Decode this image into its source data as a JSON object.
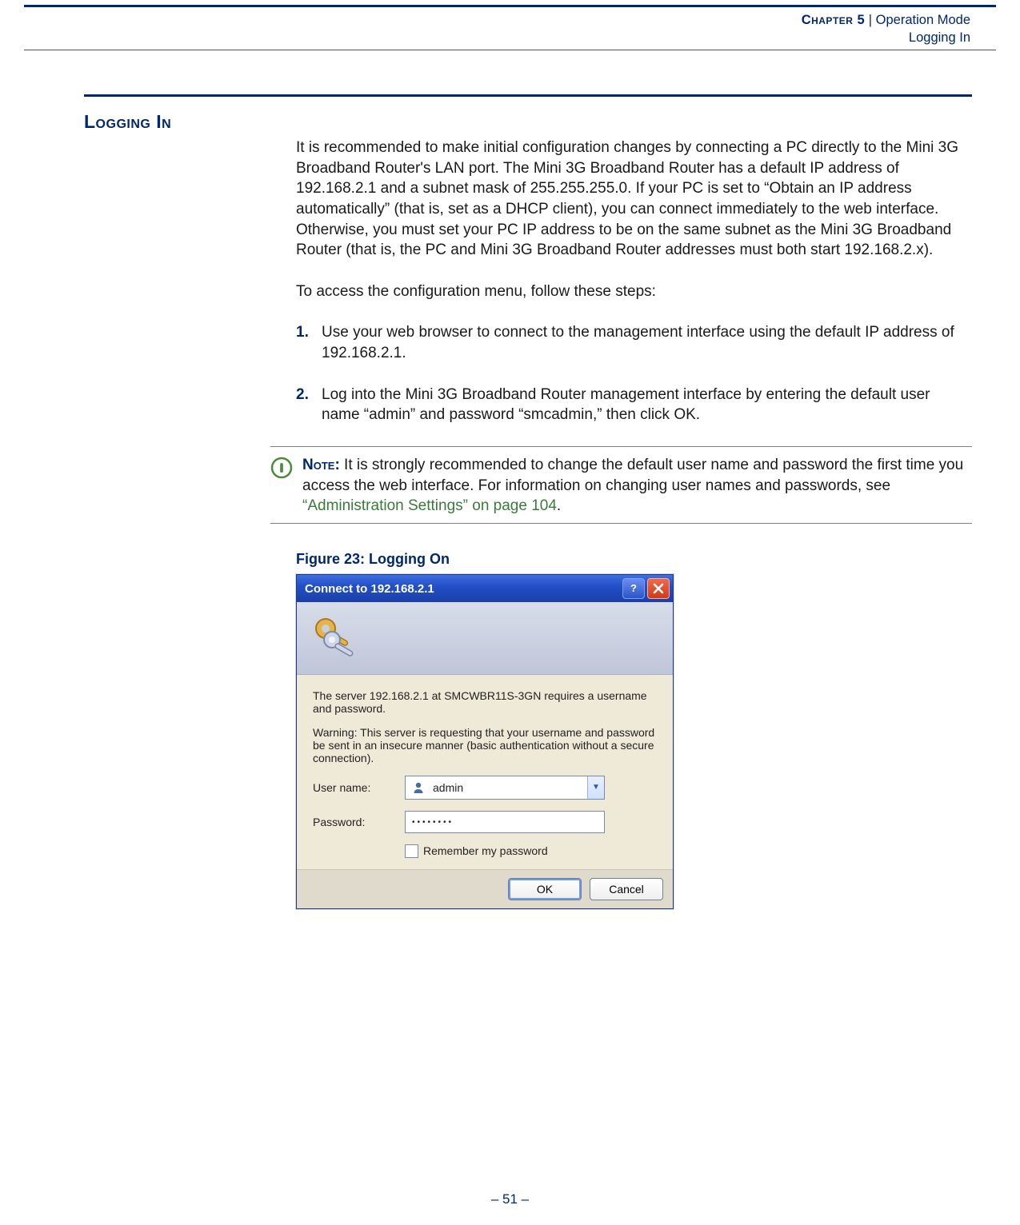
{
  "header": {
    "chapter": "Chapter 5",
    "bar": "  |  ",
    "title": "Operation Mode",
    "subtitle": "Logging In"
  },
  "section": {
    "heading": "Logging In",
    "intro": "It is recommended to make initial configuration changes by connecting a PC directly to the Mini 3G Broadband Router's LAN port. The Mini 3G Broadband Router has a default IP address of 192.168.2.1 and a subnet mask of 255.255.255.0. If your PC is set to “Obtain an IP address automatically” (that is, set as a DHCP client), you can connect immediately to the web interface. Otherwise, you must set your PC IP address to be on the same subnet as the Mini 3G Broadband Router (that is, the PC and Mini 3G Broadband Router addresses must both start 192.168.2.x).",
    "lead": "To access the configuration menu, follow these steps:",
    "steps": [
      {
        "num": "1.",
        "text": "Use your web browser to connect to the management interface using the default IP address of 192.168.2.1."
      },
      {
        "num": "2.",
        "text": "Log into the Mini 3G Broadband Router management interface by entering the default user name “admin” and password “smcadmin,” then click OK."
      }
    ]
  },
  "note": {
    "label": "Note:",
    "text_before": " It is strongly recommended to change the default user name and password the first time you access the web interface. For information on changing user names and passwords, see ",
    "xref": "“Administration Settings” on page 104",
    "text_after": "."
  },
  "figure": {
    "caption": "Figure 23:  Logging On",
    "dialog": {
      "title": "Connect to 192.168.2.1",
      "server_msg": "The server 192.168.2.1 at SMCWBR11S-3GN requires a username and password.",
      "warn_msg": "Warning: This server is requesting that your username and password be sent in an insecure manner (basic authentication without a secure connection).",
      "user_label": "User name:",
      "user_value": "admin",
      "pw_label": "Password:",
      "pw_value": "••••••••",
      "remember": "Remember my password",
      "ok": "OK",
      "cancel": "Cancel"
    }
  },
  "page_number": "–  51  –"
}
